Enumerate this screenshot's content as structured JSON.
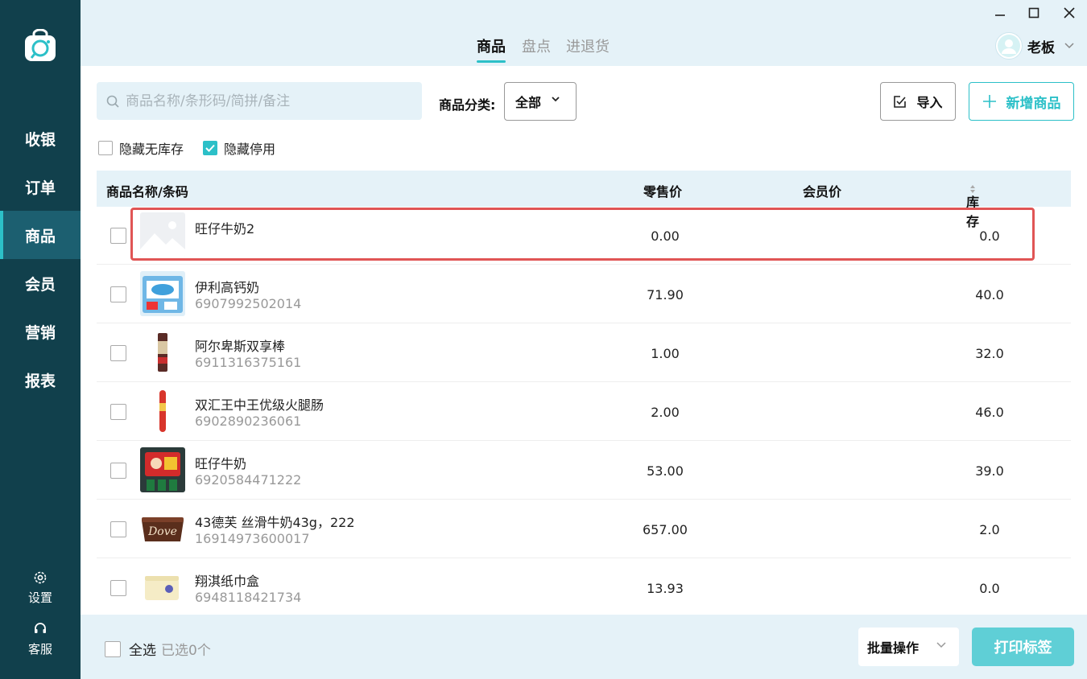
{
  "sidebar": {
    "logo": "shopping-bag-logo",
    "items": [
      {
        "label": "收银"
      },
      {
        "label": "订单"
      },
      {
        "label": "商品"
      },
      {
        "label": "会员"
      },
      {
        "label": "营销"
      },
      {
        "label": "报表"
      }
    ],
    "active_index": 2,
    "settings_label": "设置",
    "service_label": "客服"
  },
  "header": {
    "tabs": [
      {
        "label": "商品"
      },
      {
        "label": "盘点"
      },
      {
        "label": "进退货"
      }
    ],
    "active_tab": 0,
    "user_name": "老板"
  },
  "toolbar": {
    "search_placeholder": "商品名称/条形码/简拼/备注",
    "category_label": "商品分类:",
    "category_value": "全部",
    "import_label": "导入",
    "add_label": "新增商品",
    "hide_no_stock": {
      "label": "隐藏无库存",
      "checked": false
    },
    "hide_disabled": {
      "label": "隐藏停用",
      "checked": true
    }
  },
  "table": {
    "columns": {
      "name": "商品名称/条码",
      "retail_price": "零售价",
      "member_price": "会员价",
      "stock": "库存"
    },
    "rows": [
      {
        "name": "旺仔牛奶2",
        "barcode": "",
        "retail_price": "0.00",
        "member_price": "",
        "stock": "0.0",
        "image": "placeholder",
        "highlighted": true
      },
      {
        "name": "伊利高钙奶",
        "barcode": "6907992502014",
        "retail_price": "71.90",
        "member_price": "",
        "stock": "40.0",
        "image": "milk-box"
      },
      {
        "name": "阿尔卑斯双享棒",
        "barcode": "6911316375161",
        "retail_price": "1.00",
        "member_price": "",
        "stock": "32.0",
        "image": "candy-stick"
      },
      {
        "name": "双汇王中王优级火腿肠",
        "barcode": "6902890236061",
        "retail_price": "2.00",
        "member_price": "",
        "stock": "46.0",
        "image": "sausage"
      },
      {
        "name": "旺仔牛奶",
        "barcode": "6920584471222",
        "retail_price": "53.00",
        "member_price": "",
        "stock": "39.0",
        "image": "milk-can-pack"
      },
      {
        "name": "43德芙 丝滑牛奶43g，222",
        "barcode": "16914973600017",
        "retail_price": "657.00",
        "member_price": "",
        "stock": "2.0",
        "image": "chocolate-bowl"
      },
      {
        "name": "翔淇纸巾盒",
        "barcode": "6948118421734",
        "retail_price": "13.93",
        "member_price": "",
        "stock": "0.0",
        "image": "tissue-box"
      }
    ]
  },
  "footer": {
    "select_all_label": "全选",
    "selected_count": "已选0个",
    "batch_label": "批量操作",
    "print_label": "打印标签"
  },
  "colors": {
    "sidebar_bg": "#11404c",
    "sidebar_active": "#1c5f70",
    "accent": "#2cc0c8",
    "header_bg": "#e5f2f8",
    "highlight_border": "#e05555",
    "print_button": "#5fcfd6"
  }
}
